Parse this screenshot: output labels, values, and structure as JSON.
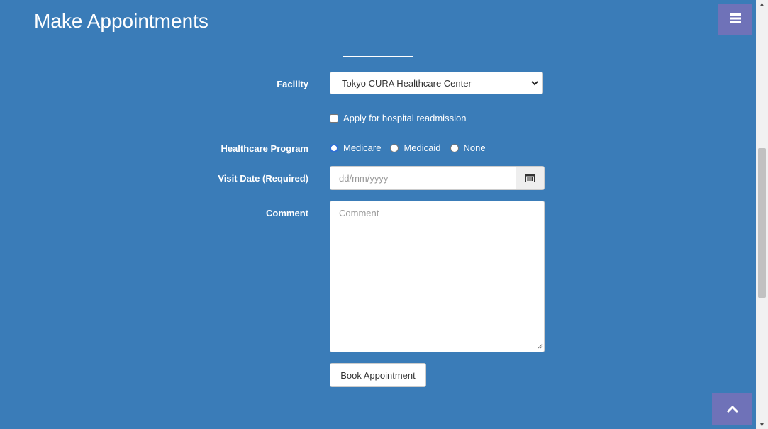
{
  "page": {
    "title": "Make Appointments"
  },
  "icons": {
    "menu": "hamburger-menu-icon",
    "scroll_top": "chevron-up-icon",
    "calendar": "calendar-icon",
    "select_chevron": "chevron-down-icon"
  },
  "colors": {
    "background": "#3a7cb8",
    "accent_button": "#6f72b8",
    "text_light": "#ffffff"
  },
  "form": {
    "facility": {
      "label": "Facility",
      "selected": "Tokyo CURA Healthcare Center"
    },
    "readmission": {
      "label": "Apply for hospital readmission",
      "checked": false
    },
    "program": {
      "label": "Healthcare Program",
      "options": [
        {
          "label": "Medicare",
          "selected": true
        },
        {
          "label": "Medicaid",
          "selected": false
        },
        {
          "label": "None",
          "selected": false
        }
      ]
    },
    "visit_date": {
      "label": "Visit Date (Required)",
      "placeholder": "dd/mm/yyyy",
      "value": ""
    },
    "comment": {
      "label": "Comment",
      "placeholder": "Comment",
      "value": ""
    },
    "submit_label": "Book Appointment"
  }
}
